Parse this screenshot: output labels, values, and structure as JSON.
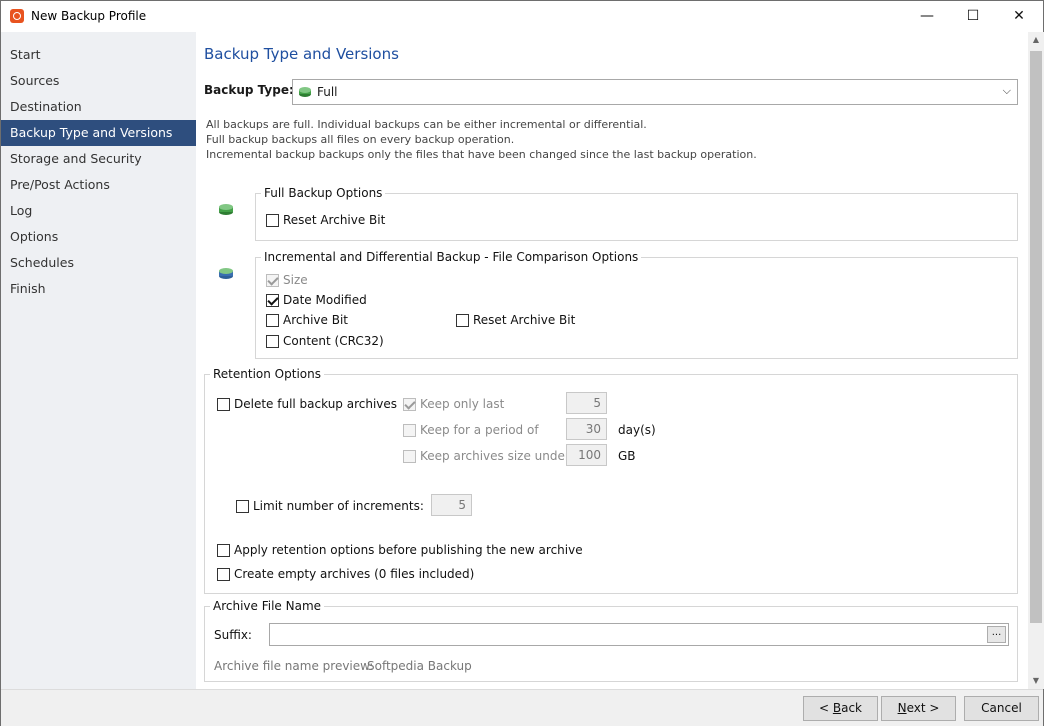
{
  "window": {
    "title": "New Backup Profile",
    "minimize_glyph": "—",
    "maximize_glyph": "☐",
    "close_glyph": "✕"
  },
  "sidebar": {
    "items": [
      {
        "label": "Start"
      },
      {
        "label": "Sources"
      },
      {
        "label": "Destination"
      },
      {
        "label": "Backup Type and Versions",
        "active": true
      },
      {
        "label": "Storage and Security"
      },
      {
        "label": "Pre/Post Actions"
      },
      {
        "label": "Log"
      },
      {
        "label": "Options"
      },
      {
        "label": "Schedules"
      },
      {
        "label": "Finish"
      }
    ]
  },
  "main": {
    "heading": "Backup Type and Versions",
    "backup_type_label": "Backup Type:",
    "backup_type_value": "Full",
    "descriptions": [
      "All backups are full. Individual backups can be either incremental or differential.",
      "Full backup backups all files on every backup operation.",
      "Incremental backup backups only the files that have been changed since the last backup operation."
    ],
    "full_options": {
      "title": "Full Backup Options",
      "reset_archive_bit": {
        "label": "Reset Archive Bit",
        "checked": false
      }
    },
    "incremental_options": {
      "title": "Incremental and Differential Backup - File Comparison Options",
      "size": {
        "label": "Size",
        "checked": true,
        "disabled": true
      },
      "date_modified": {
        "label": "Date Modified",
        "checked": true
      },
      "archive_bit": {
        "label": "Archive Bit",
        "checked": false
      },
      "reset_archive_bit": {
        "label": "Reset Archive Bit",
        "checked": false
      },
      "content": {
        "label": "Content (CRC32)",
        "checked": false
      }
    },
    "retention": {
      "title": "Retention Options",
      "delete_full": {
        "label": "Delete full backup archives",
        "checked": false
      },
      "keep_only_last": {
        "label": "Keep only last",
        "value": "5"
      },
      "keep_period": {
        "label": "Keep for a period of",
        "value": "30",
        "unit": "day(s)"
      },
      "keep_size": {
        "label": "Keep archives size under",
        "value": "100",
        "unit": "GB"
      },
      "limit_increments": {
        "label": "Limit number of increments:",
        "value": "5"
      },
      "apply_before": {
        "label": "Apply retention options before publishing the new archive"
      },
      "create_empty": {
        "label": "Create empty archives (0 files included)"
      }
    },
    "archive_name": {
      "title": "Archive File Name",
      "suffix_label": "Suffix:",
      "suffix_value": "",
      "browse_label": "...",
      "preview_label": "Archive file name preview:",
      "preview_value": "Softpedia Backup"
    }
  },
  "footer": {
    "back": {
      "mnemonic": "B",
      "rest": "ack",
      "prefix": "< "
    },
    "next": {
      "mnemonic": "N",
      "rest": "ext >"
    },
    "cancel": "Cancel"
  },
  "colors": {
    "active_nav": "#2e4e7e",
    "heading": "#1f4fa0",
    "green_icon": "#4caf50",
    "blue_icon": "#3a6fb0"
  },
  "icons": {
    "full_backup": "green-stack-icon",
    "incremental_backup": "green-blue-stack-icon"
  }
}
